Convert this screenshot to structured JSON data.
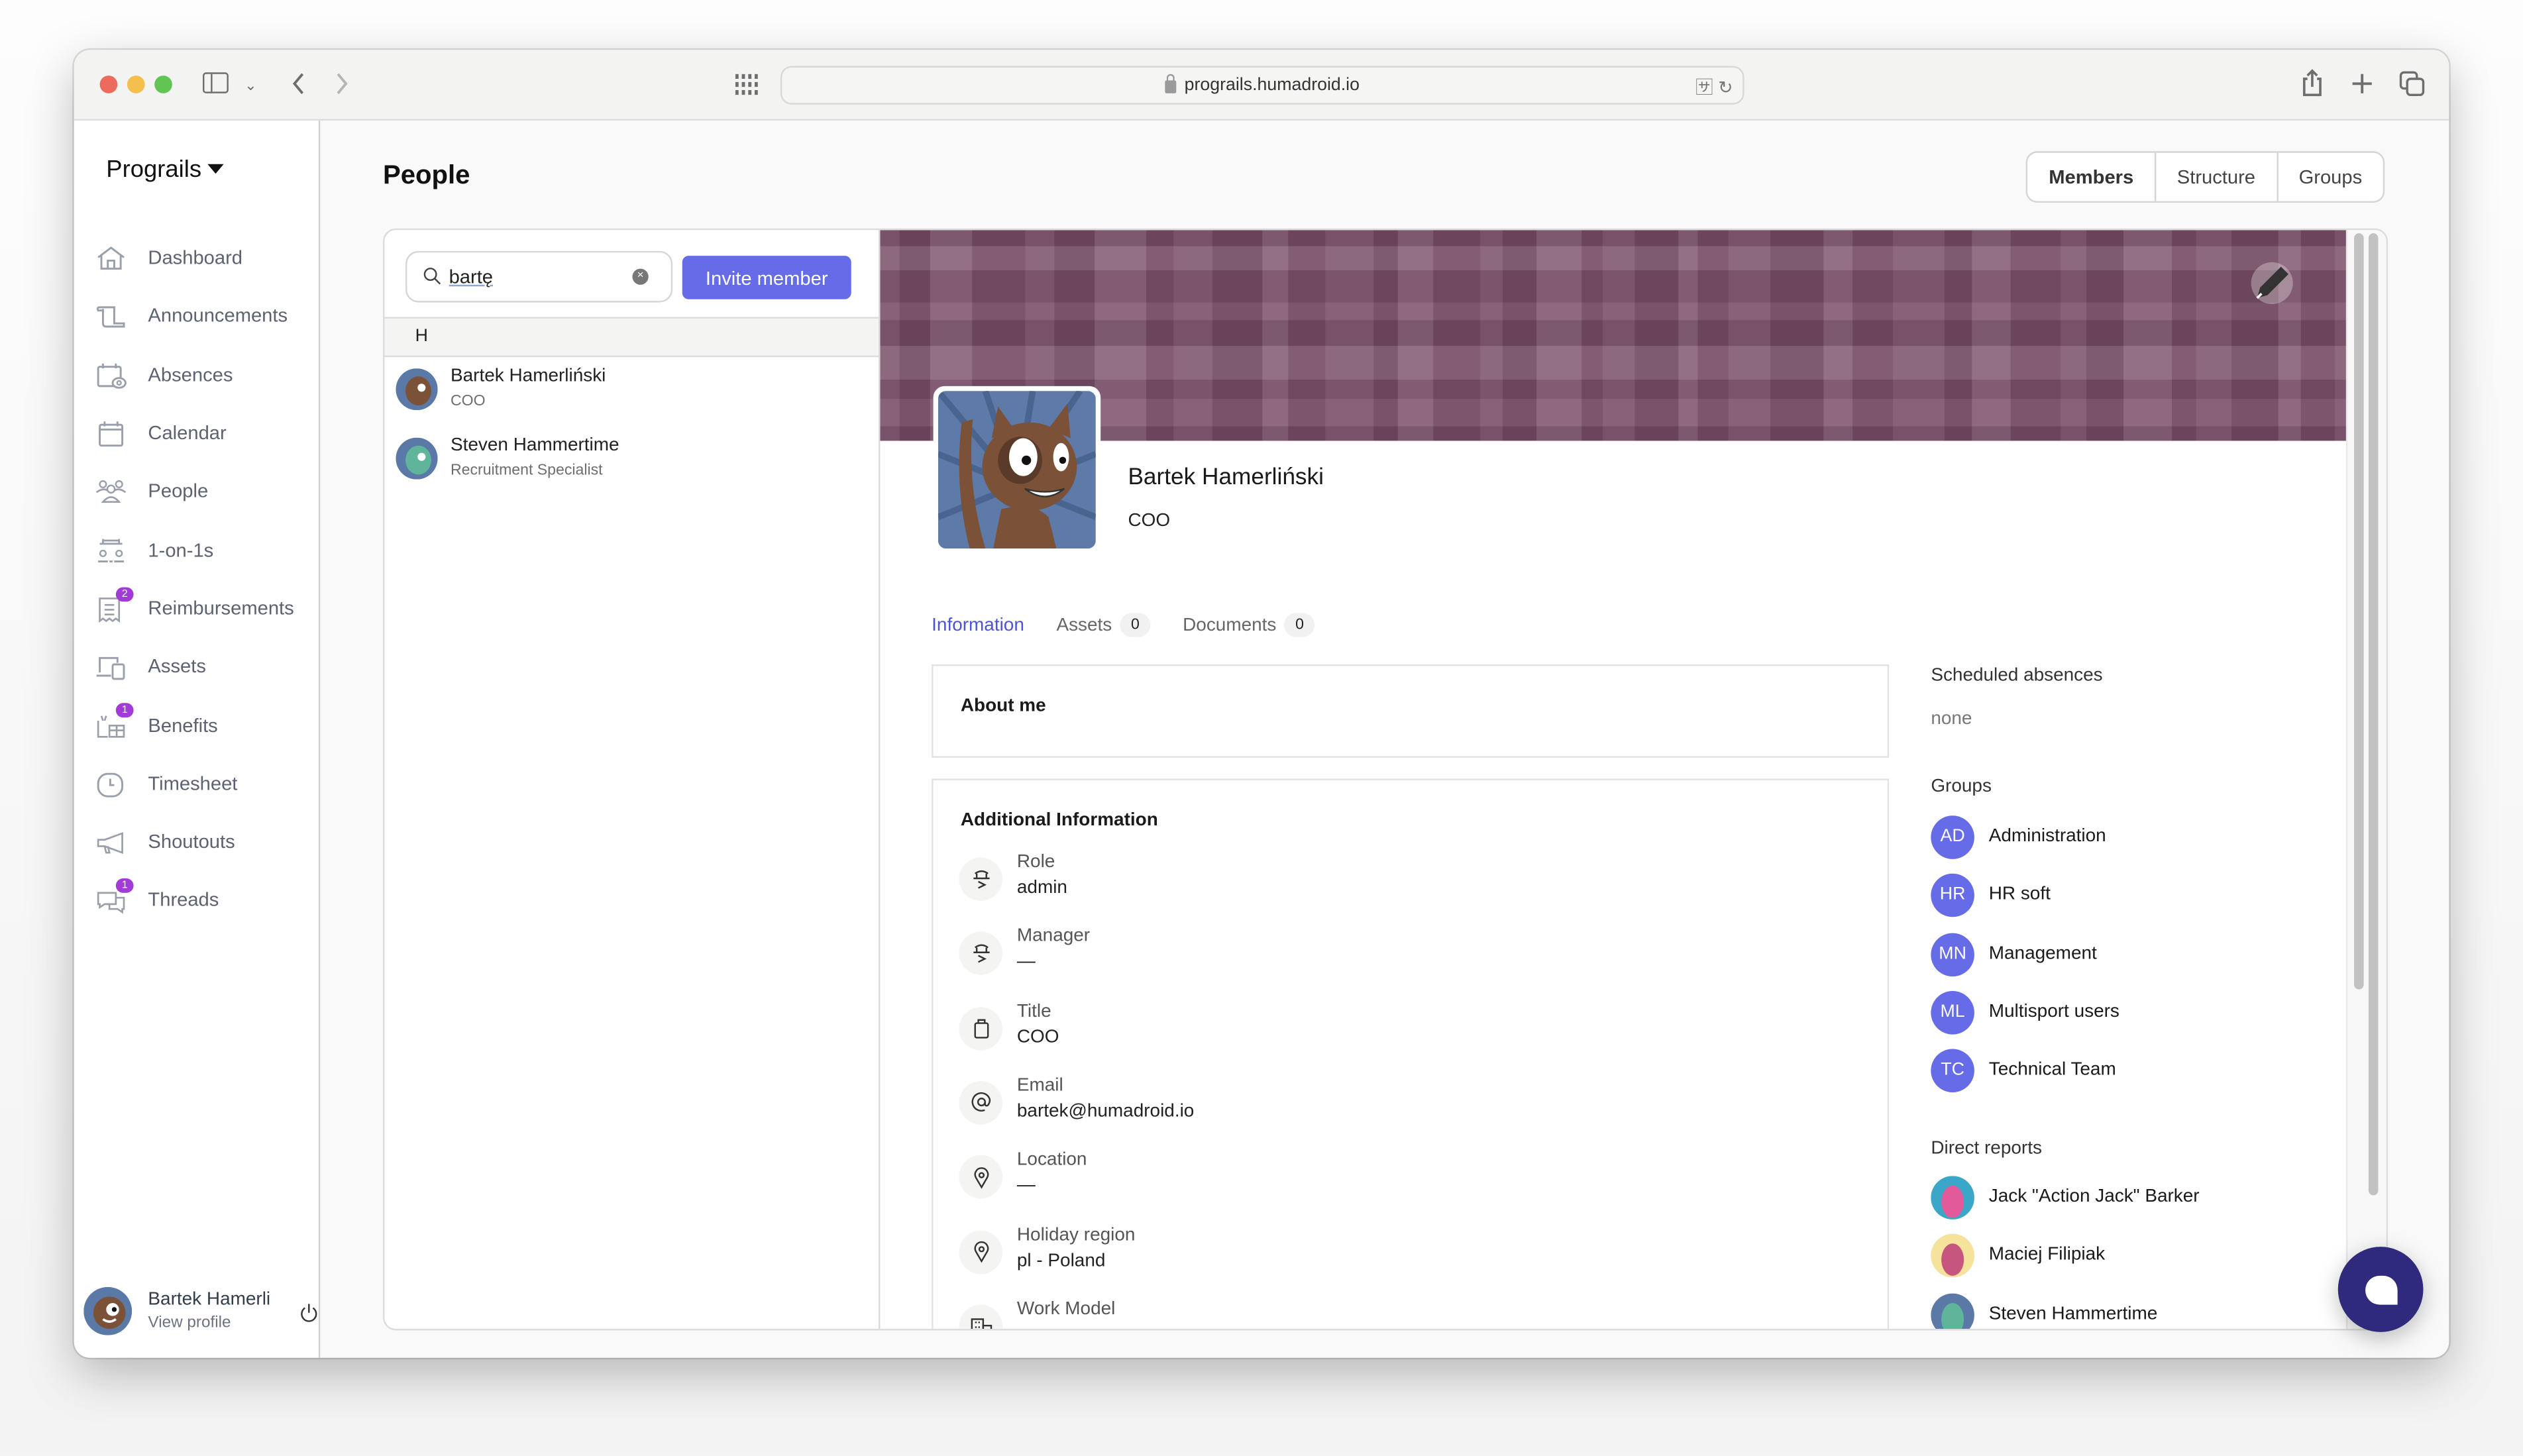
{
  "browser": {
    "url": "prograils.humadroid.io"
  },
  "sidebar": {
    "brand": "Prograils",
    "items": [
      {
        "label": "Dashboard",
        "icon": "home-icon",
        "badge": null
      },
      {
        "label": "Announcements",
        "icon": "scroll-icon",
        "badge": null
      },
      {
        "label": "Absences",
        "icon": "calendar-person-icon",
        "badge": null
      },
      {
        "label": "Calendar",
        "icon": "calendar-icon",
        "badge": null
      },
      {
        "label": "People",
        "icon": "people-icon",
        "badge": null
      },
      {
        "label": "1-on-1s",
        "icon": "meeting-icon",
        "badge": null
      },
      {
        "label": "Reimbursements",
        "icon": "receipt-icon",
        "badge": "2"
      },
      {
        "label": "Assets",
        "icon": "devices-icon",
        "badge": null
      },
      {
        "label": "Benefits",
        "icon": "gift-icon",
        "badge": "1"
      },
      {
        "label": "Timesheet",
        "icon": "clock-icon",
        "badge": null
      },
      {
        "label": "Shoutouts",
        "icon": "megaphone-icon",
        "badge": null
      },
      {
        "label": "Threads",
        "icon": "chat-icon",
        "badge": "1"
      }
    ],
    "user": {
      "name": "Bartek Hamerli",
      "link": "View profile"
    }
  },
  "page": {
    "title": "People",
    "view_tabs": [
      {
        "label": "Members",
        "active": true
      },
      {
        "label": "Structure",
        "active": false
      },
      {
        "label": "Groups",
        "active": false
      }
    ]
  },
  "list": {
    "search_value": "bartę",
    "invite_label": "Invite member",
    "letter": "H",
    "people": [
      {
        "name": "Bartek Hamerliński",
        "role": "COO"
      },
      {
        "name": "Steven Hammertime",
        "role": "Recruitment Specialist"
      }
    ]
  },
  "profile": {
    "name": "Bartek Hamerliński",
    "title": "COO",
    "tabs": [
      {
        "label": "Information",
        "count": null,
        "active": true
      },
      {
        "label": "Assets",
        "count": "0",
        "active": false
      },
      {
        "label": "Documents",
        "count": "0",
        "active": false
      }
    ],
    "about_title": "About me",
    "additional_title": "Additional Information",
    "info": [
      {
        "label": "Role",
        "value": "admin",
        "icon": "cowboy-icon"
      },
      {
        "label": "Manager",
        "value": "—",
        "icon": "cowboy-icon"
      },
      {
        "label": "Title",
        "value": "COO",
        "icon": "briefcase-icon"
      },
      {
        "label": "Email",
        "value": "bartek@humadroid.io",
        "icon": "at-icon"
      },
      {
        "label": "Location",
        "value": "—",
        "icon": "map-pin-icon"
      },
      {
        "label": "Holiday region",
        "value": "pl - Poland",
        "icon": "map-pin-icon"
      },
      {
        "label": "Work Model",
        "value": "",
        "icon": "building-icon"
      }
    ],
    "scheduled_absences_title": "Scheduled absences",
    "scheduled_absences_value": "none",
    "groups_title": "Groups",
    "groups": [
      {
        "initials": "AD",
        "name": "Administration"
      },
      {
        "initials": "HR",
        "name": "HR soft"
      },
      {
        "initials": "MN",
        "name": "Management"
      },
      {
        "initials": "ML",
        "name": "Multisport users"
      },
      {
        "initials": "TC",
        "name": "Technical Team"
      }
    ],
    "direct_reports_title": "Direct reports",
    "direct_reports": [
      {
        "name": "Jack \"Action Jack\" Barker"
      },
      {
        "name": "Maciej Filipiak"
      },
      {
        "name": "Steven Hammertime"
      }
    ]
  },
  "colors": {
    "accent": "#666be8",
    "banner": "#7a4f68",
    "badge": "#a13bd6",
    "chat_fab": "#2f2a7b"
  }
}
